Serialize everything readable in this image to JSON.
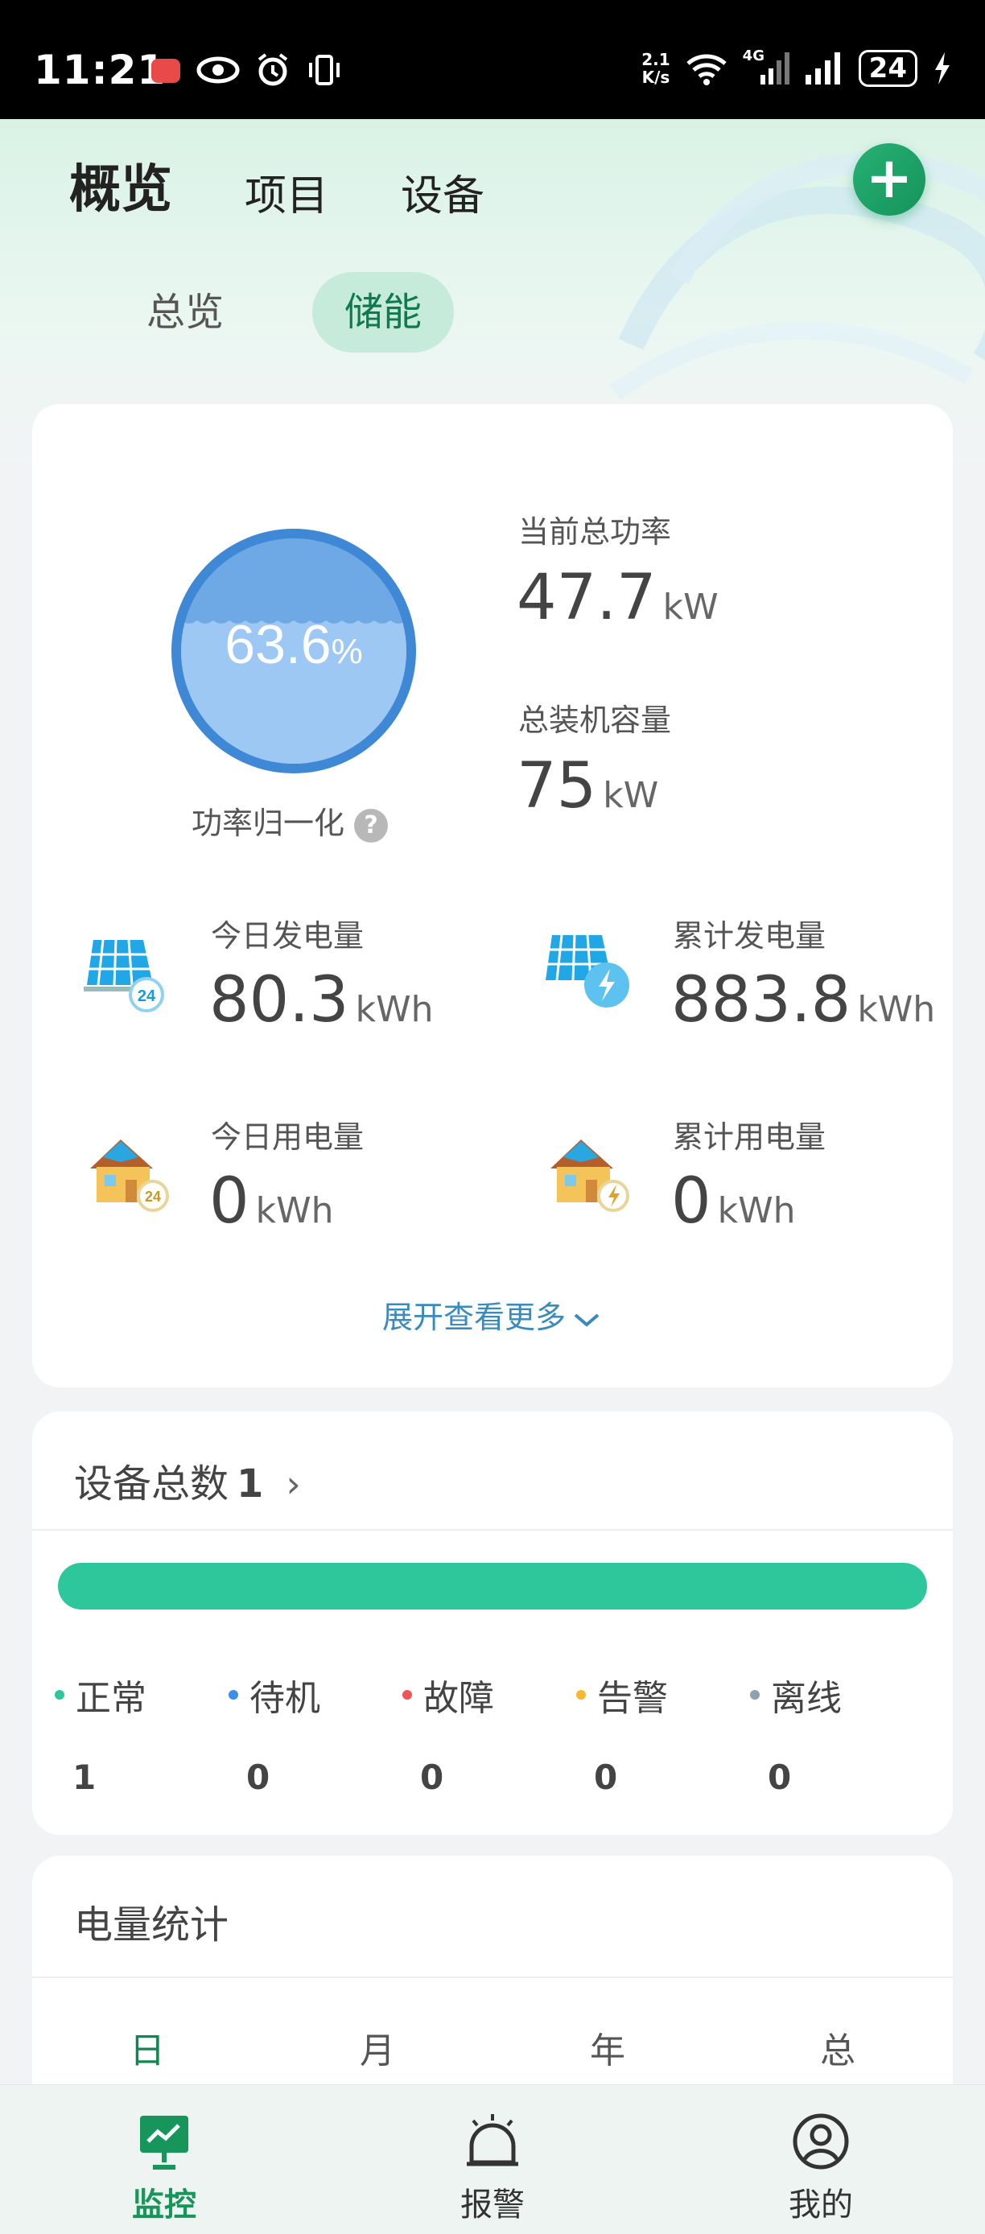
{
  "status_bar": {
    "time": "11:21",
    "net_speed": "2.1",
    "net_unit": "K/s",
    "network": "4G",
    "battery": "24"
  },
  "header": {
    "tabs": [
      {
        "label": "概览"
      },
      {
        "label": "项目"
      },
      {
        "label": "设备"
      }
    ],
    "add_button": "+",
    "sub_tabs": [
      {
        "label": "总览"
      },
      {
        "label": "储能"
      }
    ]
  },
  "overview": {
    "gauge_value": "63.6",
    "gauge_pct_sign": "%",
    "gauge_fill_fraction": 0.636,
    "gauge_label": "功率归一化",
    "help_icon": "?",
    "current_power_label": "当前总功率",
    "current_power_value": "47.7",
    "current_power_unit": "kW",
    "capacity_label": "总装机容量",
    "capacity_value": "75",
    "capacity_unit": "kW",
    "today_gen_label": "今日发电量",
    "today_gen_value": "80.3",
    "today_gen_unit": "kWh",
    "total_gen_label": "累计发电量",
    "total_gen_value": "883.8",
    "total_gen_unit": "kWh",
    "today_use_label": "今日用电量",
    "today_use_value": "0",
    "today_use_unit": "kWh",
    "total_use_label": "累计用电量",
    "total_use_value": "0",
    "total_use_unit": "kWh",
    "expand_label": "展开查看更多",
    "icon_badge": "24"
  },
  "devices": {
    "title": "设备总数",
    "count": "1",
    "chevron": "›",
    "status": [
      {
        "name": "正常",
        "count": "1",
        "color": "#2dc79b"
      },
      {
        "name": "待机",
        "count": "0",
        "color": "#3d8ee8"
      },
      {
        "name": "故障",
        "count": "0",
        "color": "#f05555"
      },
      {
        "name": "告警",
        "count": "0",
        "color": "#f5b82e"
      },
      {
        "name": "离线",
        "count": "0",
        "color": "#8fa0b0"
      }
    ]
  },
  "energy_stats": {
    "title": "电量统计",
    "period_tabs": [
      {
        "label": "日"
      },
      {
        "label": "月"
      },
      {
        "label": "年"
      },
      {
        "label": "总"
      }
    ]
  },
  "bottom_nav": [
    {
      "label": "监控",
      "icon": "monitor-icon",
      "active": true
    },
    {
      "label": "报警",
      "icon": "alarm-bell-icon",
      "active": false
    },
    {
      "label": "我的",
      "icon": "user-profile-icon",
      "active": false
    }
  ],
  "colors": {
    "accent": "#12864f",
    "bar": "#2dc79b",
    "gauge_outer": "#3f88d6",
    "gauge_inner": "#9ec8f4"
  }
}
